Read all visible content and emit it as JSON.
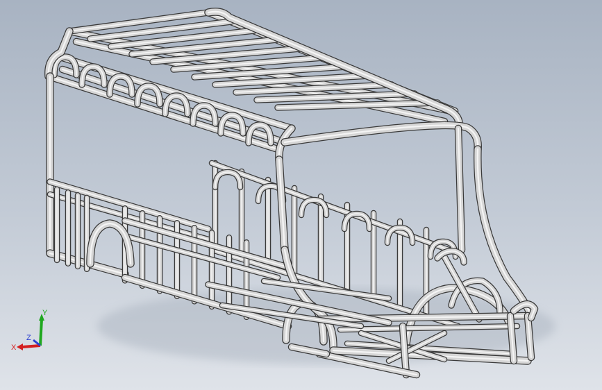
{
  "viewport": {
    "background_top": "#a8b3c2",
    "background_bottom": "#dfe3e9"
  },
  "model": {
    "name": "bus-frame-weldment",
    "tube_outline": "#3a3a3a",
    "tube_fill": "#d6d6d6",
    "tube_highlight": "#f4f4f4"
  },
  "triad": {
    "x_label": "X",
    "y_label": "Y",
    "z_label": "Z",
    "x_color": "#d42020",
    "y_color": "#1fa81f",
    "z_color": "#2a3fd0"
  }
}
